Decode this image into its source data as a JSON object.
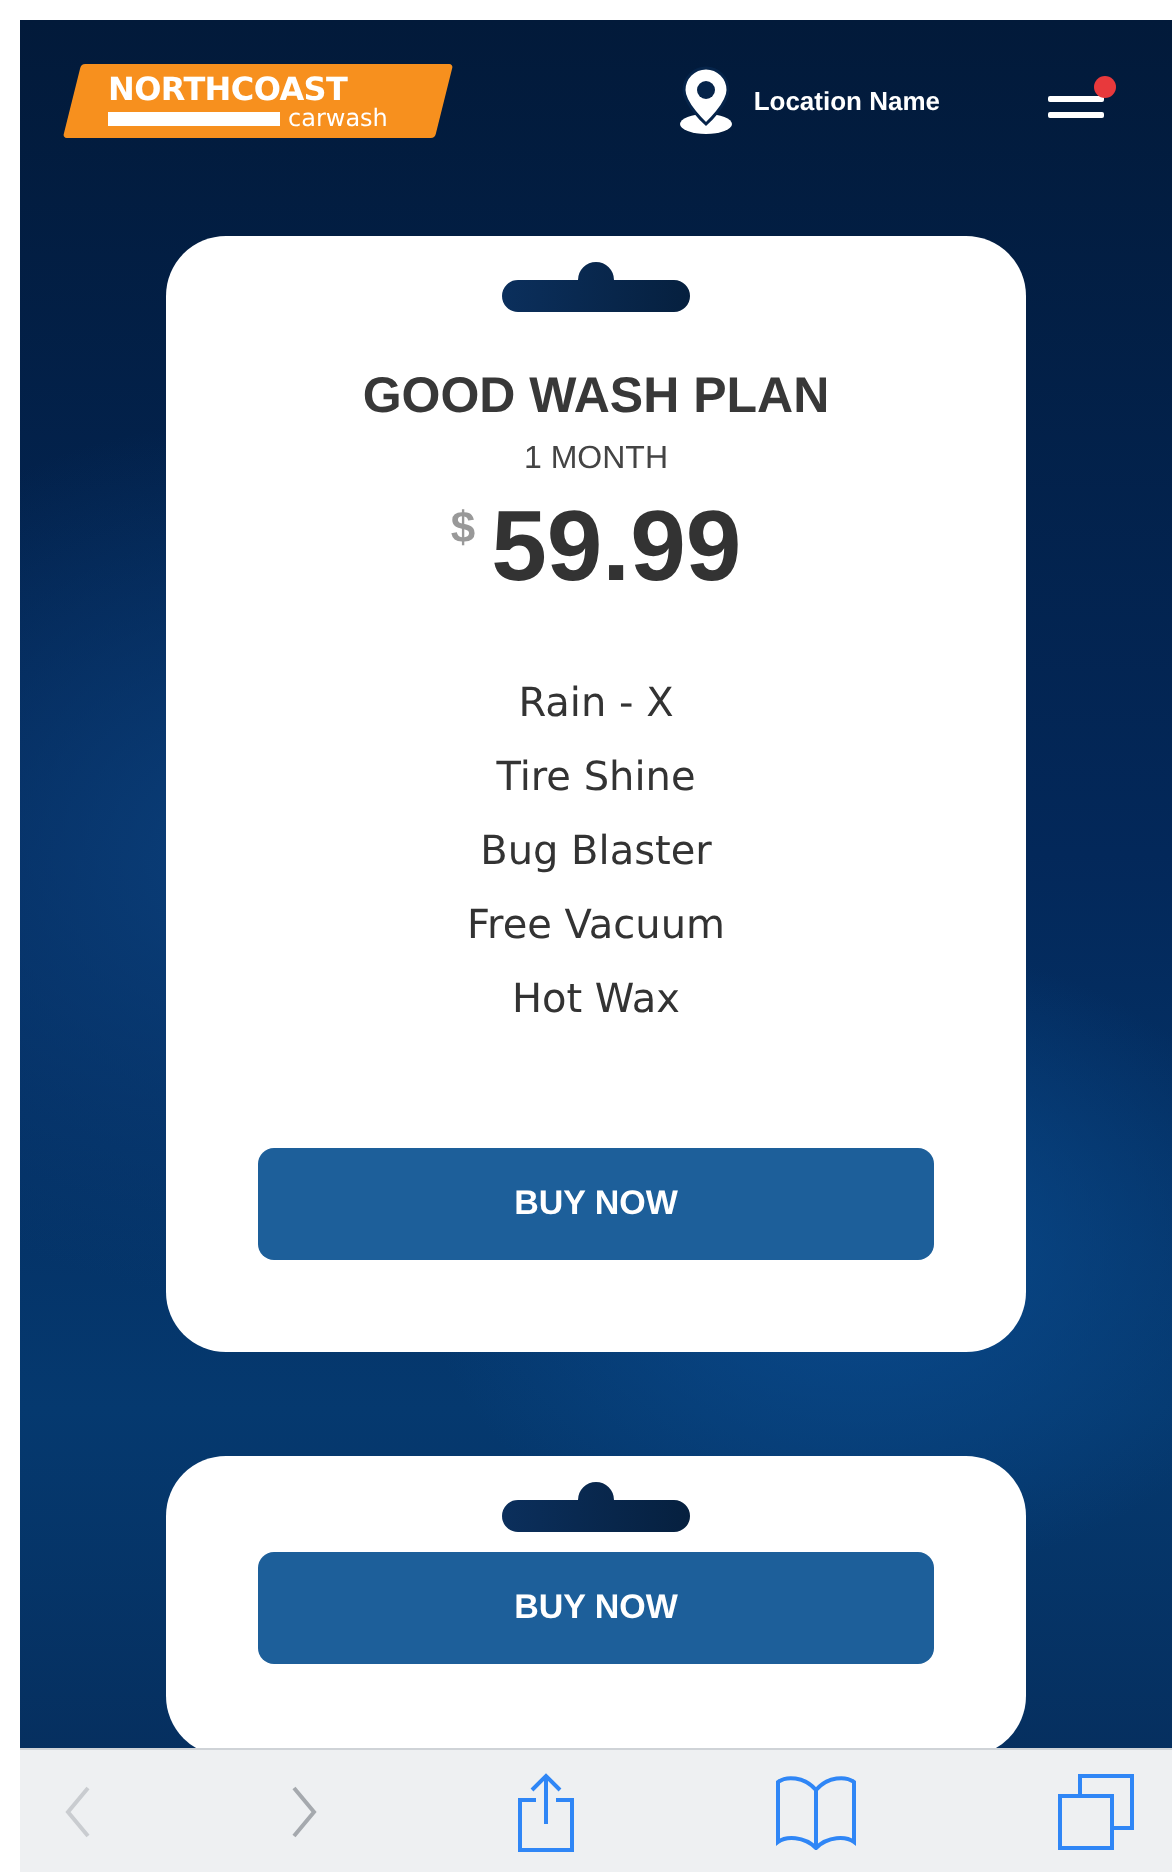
{
  "header": {
    "logo": {
      "name": "NORTHCOAST",
      "tagline": "carwash"
    },
    "location": "Location Name",
    "menu": {
      "notification": true
    }
  },
  "plans": [
    {
      "title": "GOOD WASH PLAN",
      "term": "1 MONTH",
      "currency": "$",
      "price": "59.99",
      "features": [
        "Rain - X",
        "Tire Shine",
        "Bug Blaster",
        "Free Vacuum",
        "Hot Wax"
      ],
      "button": "BUY NOW"
    },
    {
      "button": "BUY NOW"
    }
  ]
}
